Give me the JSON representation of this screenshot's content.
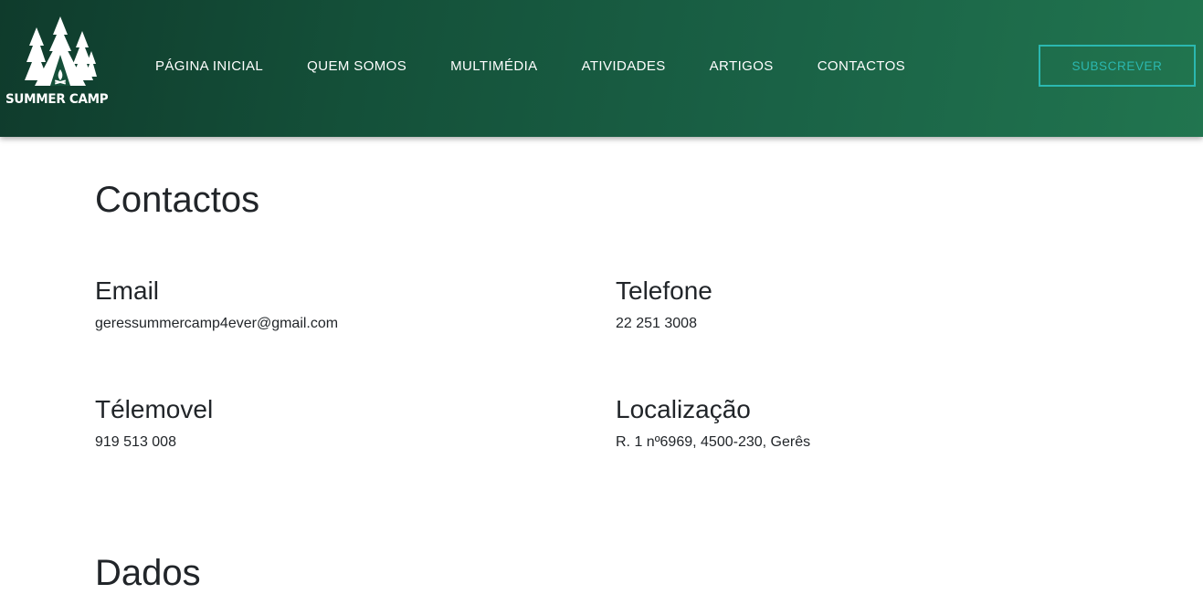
{
  "brand": {
    "name": "SUMMER CAMP",
    "logo_icon": "tent-and-pine-trees-icon"
  },
  "nav": {
    "items": [
      {
        "label": "PÁGINA INICIAL"
      },
      {
        "label": "QUEM SOMOS"
      },
      {
        "label": "MULTIMÉDIA"
      },
      {
        "label": "ATIVIDADES"
      },
      {
        "label": "ARTIGOS"
      },
      {
        "label": "CONTACTOS"
      }
    ],
    "subscribe_label": "SUBSCREVER"
  },
  "colors": {
    "header_dark": "#0f3b2c",
    "header_light": "#21754f",
    "accent": "#2bb8b0",
    "text": "#212529"
  },
  "contacts": {
    "title": "Contactos",
    "email": {
      "label": "Email",
      "value": "geressummercamp4ever@gmail.com"
    },
    "phone": {
      "label": "Telefone",
      "value": "22 251 3008"
    },
    "mobile": {
      "label": "Télemovel",
      "value": "919 513 008"
    },
    "location": {
      "label": "Localização",
      "value": "R. 1 nº6969, 4500-230, Gerês"
    }
  },
  "next_section": {
    "title": "Dados"
  }
}
